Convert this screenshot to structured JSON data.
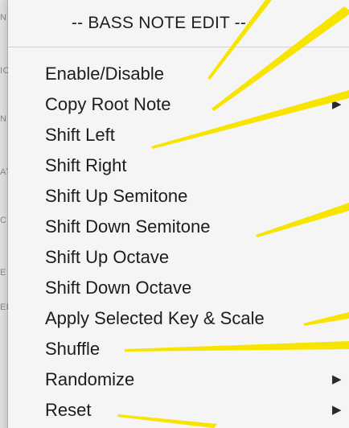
{
  "colors": {
    "callout": "#f7e400",
    "menu_bg": "#f5f5f5",
    "text": "#1c1c1c"
  },
  "background_labels": [
    "N",
    "IC",
    "N",
    "AT",
    "C",
    "E",
    "EF"
  ],
  "menu": {
    "header": "-- BASS NOTE EDIT --",
    "items": [
      {
        "label": "Enable/Disable",
        "has_submenu": false
      },
      {
        "label": "Copy Root Note",
        "has_submenu": true
      },
      {
        "label": "Shift Left",
        "has_submenu": false
      },
      {
        "label": "Shift Right",
        "has_submenu": false
      },
      {
        "label": "Shift Up Semitone",
        "has_submenu": false
      },
      {
        "label": "Shift Down Semitone",
        "has_submenu": false
      },
      {
        "label": "Shift Up Octave",
        "has_submenu": false
      },
      {
        "label": "Shift Down Octave",
        "has_submenu": false
      },
      {
        "label": "Apply Selected Key & Scale",
        "has_submenu": false
      },
      {
        "label": "Shuffle",
        "has_submenu": false
      },
      {
        "label": "Randomize",
        "has_submenu": true
      },
      {
        "label": "Reset",
        "has_submenu": true
      }
    ],
    "submenu_arrow_glyph": "▶"
  }
}
